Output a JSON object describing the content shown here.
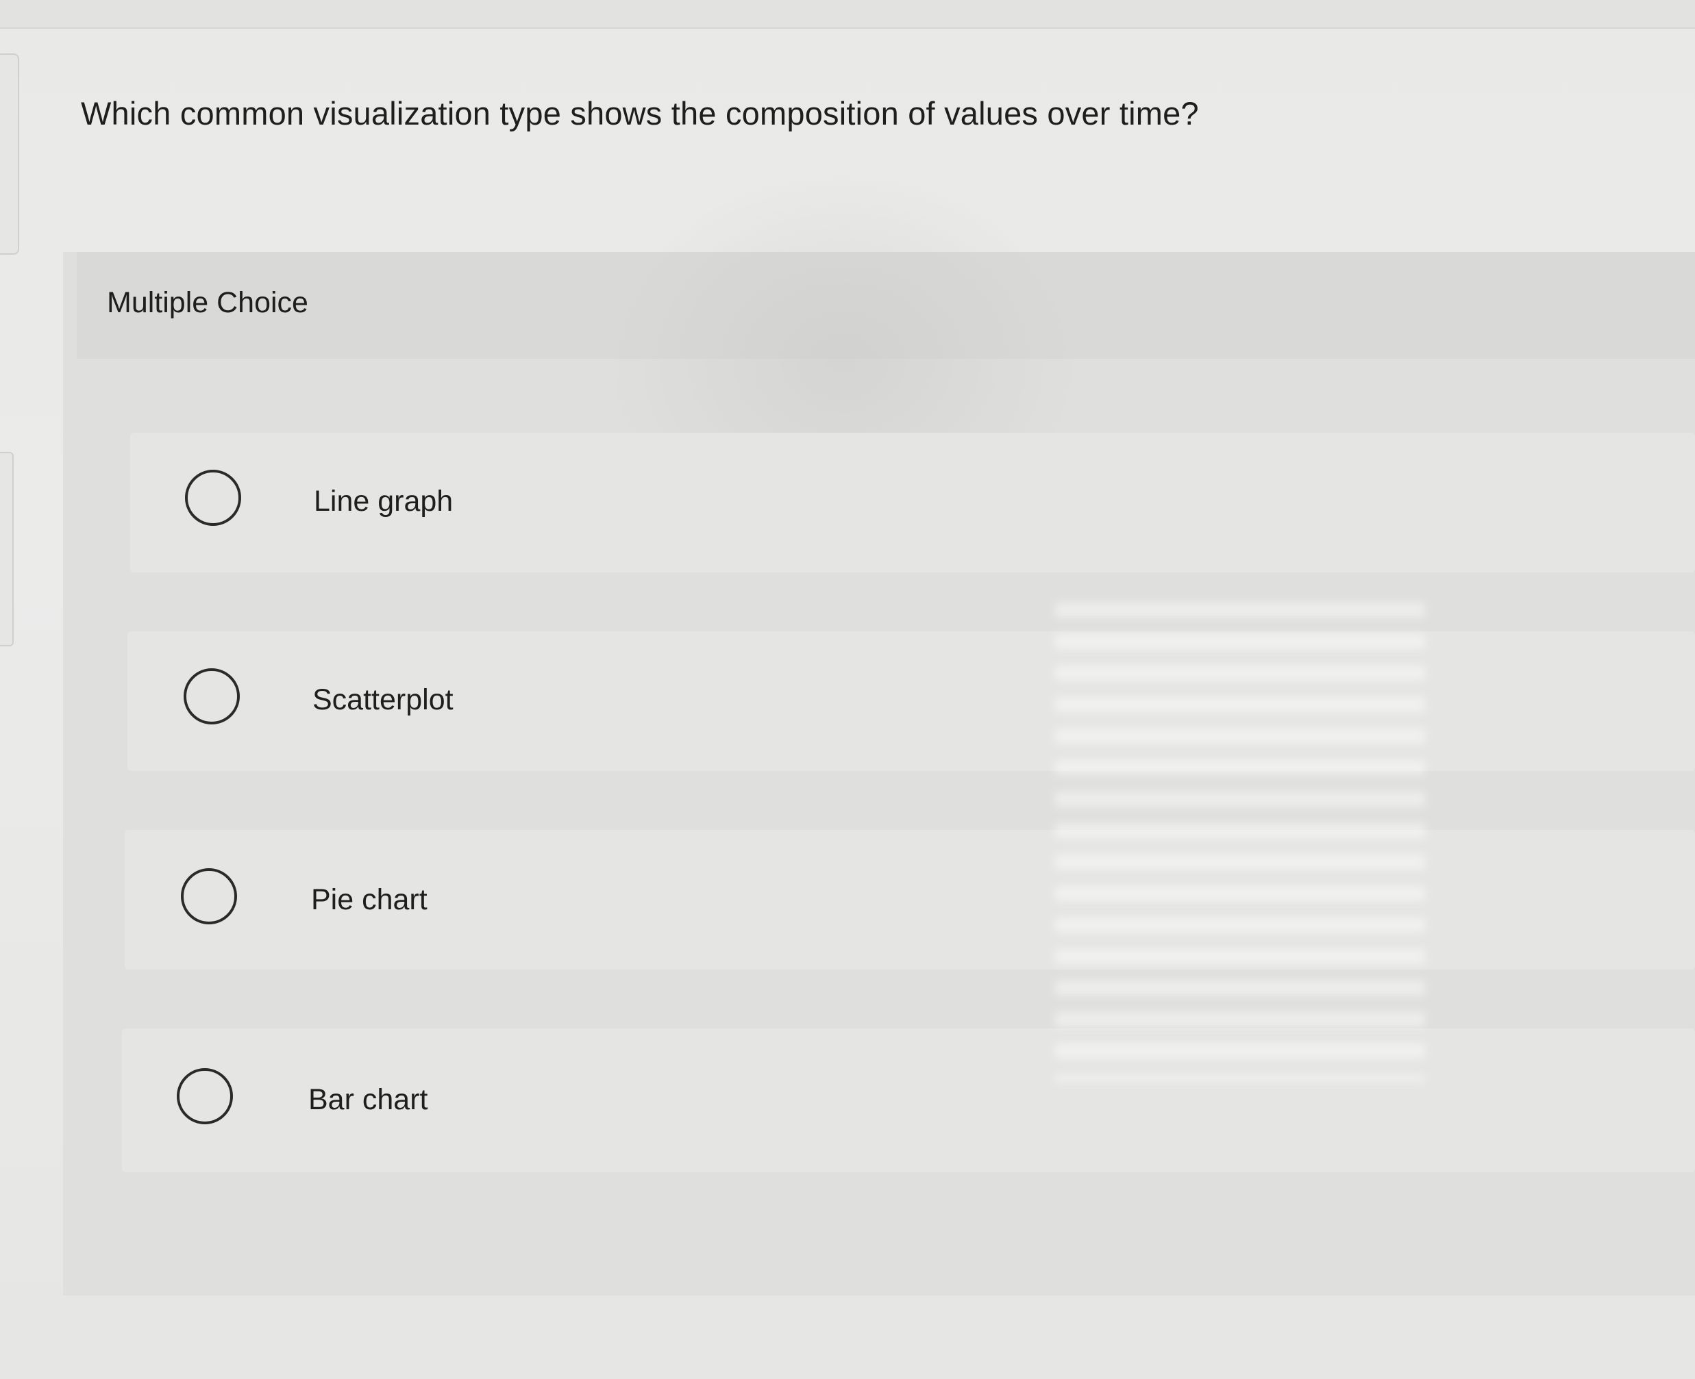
{
  "question": {
    "text": "Which common visualization type shows the composition of values over time?"
  },
  "answer_panel": {
    "type_label": "Multiple Choice",
    "options": [
      {
        "label": "Line graph",
        "selected": false
      },
      {
        "label": "Scatterplot",
        "selected": false
      },
      {
        "label": "Pie chart",
        "selected": false
      },
      {
        "label": "Bar chart",
        "selected": false
      }
    ]
  }
}
